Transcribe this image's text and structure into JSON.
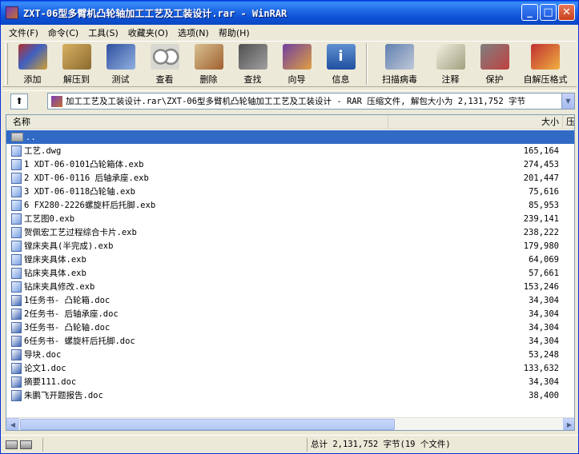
{
  "window": {
    "title": "ZXT-06型多臂机凸轮轴加工工艺及工装设计.rar - WinRAR",
    "min_glyph": "_",
    "max_glyph": "□",
    "close_glyph": "✕"
  },
  "menu": [
    {
      "label": "文件(F)"
    },
    {
      "label": "命令(C)"
    },
    {
      "label": "工具(S)"
    },
    {
      "label": "收藏夹(O)"
    },
    {
      "label": "选项(N)"
    },
    {
      "label": "帮助(H)"
    }
  ],
  "toolbar": [
    {
      "label": "添加",
      "icon": "add-icon"
    },
    {
      "label": "解压到",
      "icon": "extract-icon"
    },
    {
      "label": "测试",
      "icon": "test-icon"
    },
    {
      "label": "查看",
      "icon": "view-icon"
    },
    {
      "label": "删除",
      "icon": "delete-icon"
    },
    {
      "label": "查找",
      "icon": "find-icon"
    },
    {
      "label": "向导",
      "icon": "wizard-icon"
    },
    {
      "label": "信息",
      "icon": "info-icon"
    },
    {
      "label": "扫描病毒",
      "icon": "virus-scan-icon"
    },
    {
      "label": "注释",
      "icon": "comment-icon"
    },
    {
      "label": "保护",
      "icon": "protect-icon"
    },
    {
      "label": "自解压格式",
      "icon": "sfx-icon"
    }
  ],
  "address": {
    "text": "加工工艺及工装设计.rar\\ZXT-06型多臂机凸轮轴加工工艺及工装设计 - RAR 压缩文件, 解包大小为 2,131,752 字节"
  },
  "columns": {
    "name": "名称",
    "size": "大小",
    "packed": "压"
  },
  "files": [
    {
      "name": "..",
      "size": "",
      "type": "folder"
    },
    {
      "name": "工艺.dwg",
      "size": "165,164",
      "type": "file"
    },
    {
      "name": "1 XDT-06-0101凸轮箱体.exb",
      "size": "274,453",
      "type": "file"
    },
    {
      "name": "2 XDT-06-0116 后轴承座.exb",
      "size": "201,447",
      "type": "file"
    },
    {
      "name": "3 XDT-06-0118凸轮轴.exb",
      "size": "75,616",
      "type": "file"
    },
    {
      "name": "6 FX280-2226螺旋杆后托脚.exb",
      "size": "85,953",
      "type": "file"
    },
    {
      "name": "工艺图0.exb",
      "size": "239,141",
      "type": "file"
    },
    {
      "name": "贺佩宏工艺过程综合卡片.exb",
      "size": "238,222",
      "type": "file"
    },
    {
      "name": "镗床夹具(半完成).exb",
      "size": "179,980",
      "type": "file"
    },
    {
      "name": "镗床夹具体.exb",
      "size": "64,069",
      "type": "file"
    },
    {
      "name": "钻床夹具体.exb",
      "size": "57,661",
      "type": "file"
    },
    {
      "name": "钻床夹具修改.exb",
      "size": "153,246",
      "type": "file"
    },
    {
      "name": "1任务书- 凸轮箱.doc",
      "size": "34,304",
      "type": "doc"
    },
    {
      "name": "2任务书- 后轴承座.doc",
      "size": "34,304",
      "type": "doc"
    },
    {
      "name": "3任务书- 凸轮轴.doc",
      "size": "34,304",
      "type": "doc"
    },
    {
      "name": "6任务书- 螺旋杆后托脚.doc",
      "size": "34,304",
      "type": "doc"
    },
    {
      "name": "导块.doc",
      "size": "53,248",
      "type": "doc"
    },
    {
      "name": "论文1.doc",
      "size": "133,632",
      "type": "doc"
    },
    {
      "name": "摘要111.doc",
      "size": "34,304",
      "type": "doc"
    },
    {
      "name": "朱鹏飞开题报告.doc",
      "size": "38,400",
      "type": "doc"
    }
  ],
  "status": {
    "left": "",
    "right": "总计 2,131,752 字节(19 个文件)"
  }
}
